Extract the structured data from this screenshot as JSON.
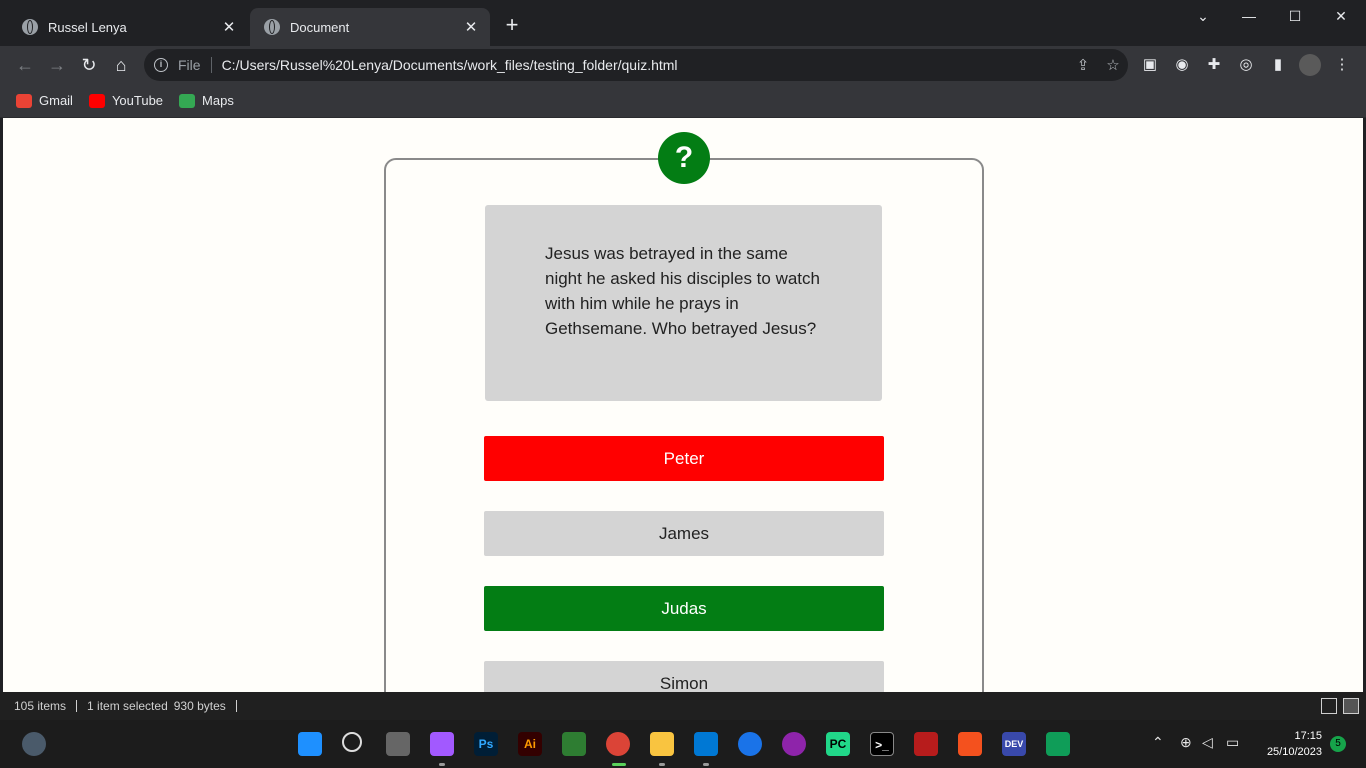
{
  "browser": {
    "tabs": [
      {
        "title": "Russel Lenya",
        "active": false
      },
      {
        "title": "Document",
        "active": true
      }
    ],
    "new_tab": "+",
    "window_controls": {
      "tabsearch": "⌄",
      "minimize": "—",
      "maximize": "☐",
      "close": "✕"
    },
    "nav": {
      "back": "←",
      "forward": "→",
      "reload": "↻",
      "home": "⌂"
    },
    "address": {
      "scheme_label": "File",
      "url": "C:/Users/Russel%20Lenya/Documents/work_files/testing_folder/quiz.html"
    },
    "bookmarks": [
      {
        "label": "Gmail",
        "color": "#ea4335"
      },
      {
        "label": "YouTube",
        "color": "#ff0000"
      },
      {
        "label": "Maps",
        "color": "#34a853"
      }
    ]
  },
  "quiz": {
    "icon_glyph": "?",
    "question": "Jesus was betrayed in the same night he asked his disciples to watch with him while he prays in Gethsemane. Who betrayed Jesus?",
    "answers": [
      {
        "label": "Peter",
        "state": "wrong"
      },
      {
        "label": "James",
        "state": "neutral"
      },
      {
        "label": "Judas",
        "state": "correct"
      },
      {
        "label": "Simon",
        "state": "neutral"
      }
    ],
    "colors": {
      "wrong": "#ff0000",
      "correct": "#037d14",
      "neutral": "#d4d4d4",
      "accent": "#037d14"
    }
  },
  "explorer_status": {
    "items": "105 items",
    "selection": "1 item selected",
    "size": "930 bytes"
  },
  "taskbar": {
    "apps": [
      "start",
      "search",
      "task-view",
      "figma",
      "photoshop",
      "illustrator",
      "app-3d",
      "chrome",
      "file-explorer",
      "vscode",
      "app-store",
      "github-desktop",
      "pycharm",
      "terminal",
      "app-grid",
      "git-app",
      "dev-app",
      "classroom"
    ],
    "labels": {
      "photoshop": "Ps",
      "illustrator": "Ai",
      "pycharm": "PC",
      "terminal": ">_",
      "dev-app": "DEV"
    },
    "clock_time": "17:15",
    "clock_date": "25/10/2023",
    "notification_count": "5"
  }
}
